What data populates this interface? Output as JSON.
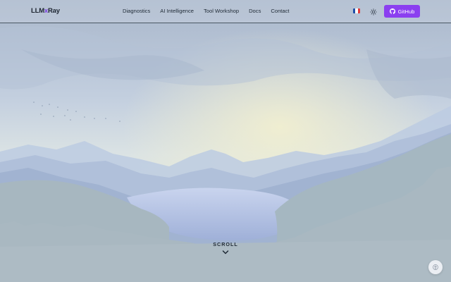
{
  "brand": {
    "part1": "LLM",
    "part2": "x",
    "part3": "Ray"
  },
  "nav": {
    "links": [
      {
        "label": "Diagnostics"
      },
      {
        "label": "AI Intelligence"
      },
      {
        "label": "Tool Workshop"
      },
      {
        "label": "Docs"
      },
      {
        "label": "Contact"
      }
    ]
  },
  "language": {
    "icon": "french-flag-icon",
    "colors": [
      "#1f4fa8",
      "#ffffff",
      "#e23a3a"
    ]
  },
  "theme_toggle": {
    "icon": "sun-icon"
  },
  "github": {
    "label": "GitHub",
    "icon": "github-icon",
    "color": "#8b3ff0"
  },
  "hero": {
    "scroll_label": "SCROLL",
    "scroll_icon": "chevron-down-icon",
    "background": "misty-mountain-lake-landscape"
  },
  "corner_button": {
    "icon": "accessibility-icon"
  },
  "colors": {
    "accent": "#8b3ff0",
    "brand_accent": "#7a3fe0",
    "text": "#1f2a36"
  }
}
